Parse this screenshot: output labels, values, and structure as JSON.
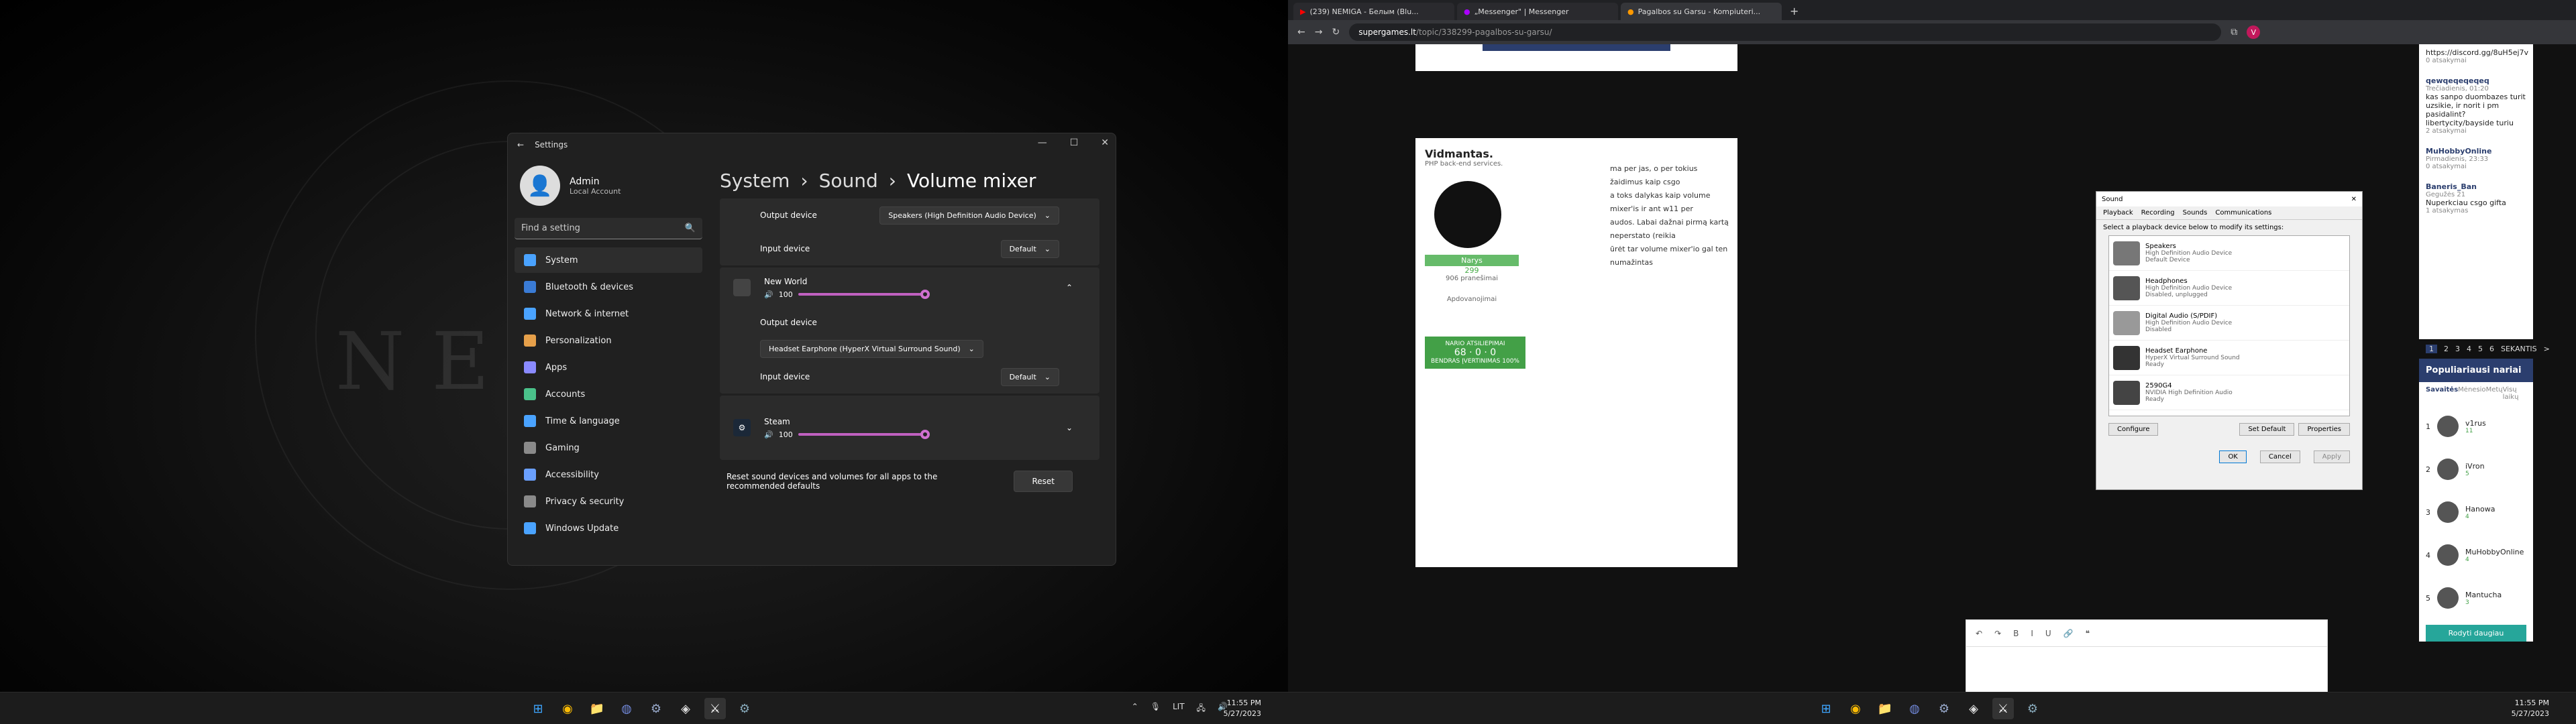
{
  "left_monitor": {
    "background_word": "NEW",
    "settings": {
      "title": "Settings",
      "profile": {
        "name": "Admin",
        "account": "Local Account"
      },
      "search_placeholder": "Find a setting",
      "nav": [
        "System",
        "Bluetooth & devices",
        "Network & internet",
        "Personalization",
        "Apps",
        "Accounts",
        "Time & language",
        "Gaming",
        "Accessibility",
        "Privacy & security",
        "Windows Update"
      ],
      "breadcrumb": [
        "System",
        "Sound",
        "Volume mixer"
      ],
      "output_device_label": "Output device",
      "output_device_value": "Speakers (High Definition Audio Device)",
      "input_device_label": "Input device",
      "input_device_value": "Default",
      "apps": [
        {
          "name": "New World",
          "volume": "100",
          "output_label": "Output device",
          "output_value": "Headset Earphone (HyperX Virtual Surround Sound)",
          "input_label": "Input device",
          "input_value": "Default"
        },
        {
          "name": "Steam",
          "volume": "100"
        }
      ],
      "reset_text": "Reset sound devices and volumes for all apps to the recommended defaults",
      "reset_button": "Reset"
    },
    "clock": {
      "time": "11:55 PM",
      "date": "5/27/2023"
    },
    "tray_lang": "LIT"
  },
  "right_monitor": {
    "tabs": [
      "(239) NEMIGA - Белым (Blu...",
      "„Messenger\" | Messenger",
      "Pagalbos su Garsu - Kompiuteri..."
    ],
    "url_domain": "supergames.lt",
    "url_path": "/topic/338299-pagalbos-su-garsu/",
    "post": {
      "author": "Vidmantas.",
      "subtitle": "PHP back-end services.",
      "rank": "Narys",
      "points": "299",
      "posts": "906 pranešimai",
      "awards_label": "Apdovanojimai",
      "rep_label": "NARIO ATSILIEPIMAI",
      "rep_counts": [
        "68",
        "0",
        "0"
      ],
      "rep_total": "BENDRAS ĮVERTINIMAS 100%",
      "body_lines": [
        "ma per jas, o per tokius žaidimus kaip csgo",
        "a toks dalykas kaip volume mixer'is ir ant w11 per",
        "audos. Labai dažnai pirmą kartą neperstato (reikia",
        "ūrėt tar volume mixer'io gal ten numažintas"
      ]
    },
    "sound_dialog": {
      "title": "Sound",
      "tabs": [
        "Playback",
        "Recording",
        "Sounds",
        "Communications"
      ],
      "instruction": "Select a playback device below to modify its settings:",
      "devices": [
        {
          "name": "Speakers",
          "driver": "High Definition Audio Device",
          "status": "Default Device"
        },
        {
          "name": "Headphones",
          "driver": "High Definition Audio Device",
          "status": "Disabled, unplugged"
        },
        {
          "name": "Digital Audio (S/PDIF)",
          "driver": "High Definition Audio Device",
          "status": "Disabled"
        },
        {
          "name": "Headset Earphone",
          "driver": "HyperX Virtual Surround Sound",
          "status": "Ready"
        },
        {
          "name": "2590G4",
          "driver": "NVIDIA High Definition Audio",
          "status": "Ready"
        }
      ],
      "configure": "Configure",
      "set_default": "Set Default",
      "properties": "Properties",
      "ok": "OK",
      "cancel": "Cancel",
      "apply": "Apply"
    },
    "sidebar_feed": [
      {
        "user": "",
        "text": "https://discord.gg/8uH5ej7v",
        "replies": "0 atsakymai",
        "time": ""
      },
      {
        "user": "qewqeqeqeqeq",
        "text": "kas sanpo duombazes turit uzsikie, ir norit i pm pasidalint? libertycity/bayside turiu",
        "replies": "2 atsakymai",
        "time": "Trečiadienis, 01:20"
      },
      {
        "user": "MuHobbyOnline",
        "text": "",
        "replies": "0 atsakymai",
        "time": "Pirmadienis, 23:33"
      },
      {
        "user": "Baneris_Ban",
        "text": "Nuperkciau csgo gifta",
        "replies": "1 atsakymas",
        "time": "Gegužės 21"
      }
    ],
    "pagination": [
      "1",
      "2",
      "3",
      "4",
      "5",
      "6",
      "SEKANTIS",
      ">"
    ],
    "popular": {
      "title": "Populiariausi nariai",
      "tabs": [
        "Savaitės",
        "Mėnesio",
        "Metų",
        "Visų laikų"
      ],
      "members": [
        {
          "rank": "1",
          "name": "v1rus",
          "score": "11"
        },
        {
          "rank": "2",
          "name": "iVron",
          "score": "5"
        },
        {
          "rank": "3",
          "name": "Hanowa",
          "score": "4"
        },
        {
          "rank": "4",
          "name": "MuHobbyOnline",
          "score": "4"
        },
        {
          "rank": "5",
          "name": "Mantucha",
          "score": "3"
        }
      ],
      "more_button": "Rodyti daugiau"
    },
    "clock": {
      "time": "11:55 PM",
      "date": "5/27/2023"
    }
  }
}
